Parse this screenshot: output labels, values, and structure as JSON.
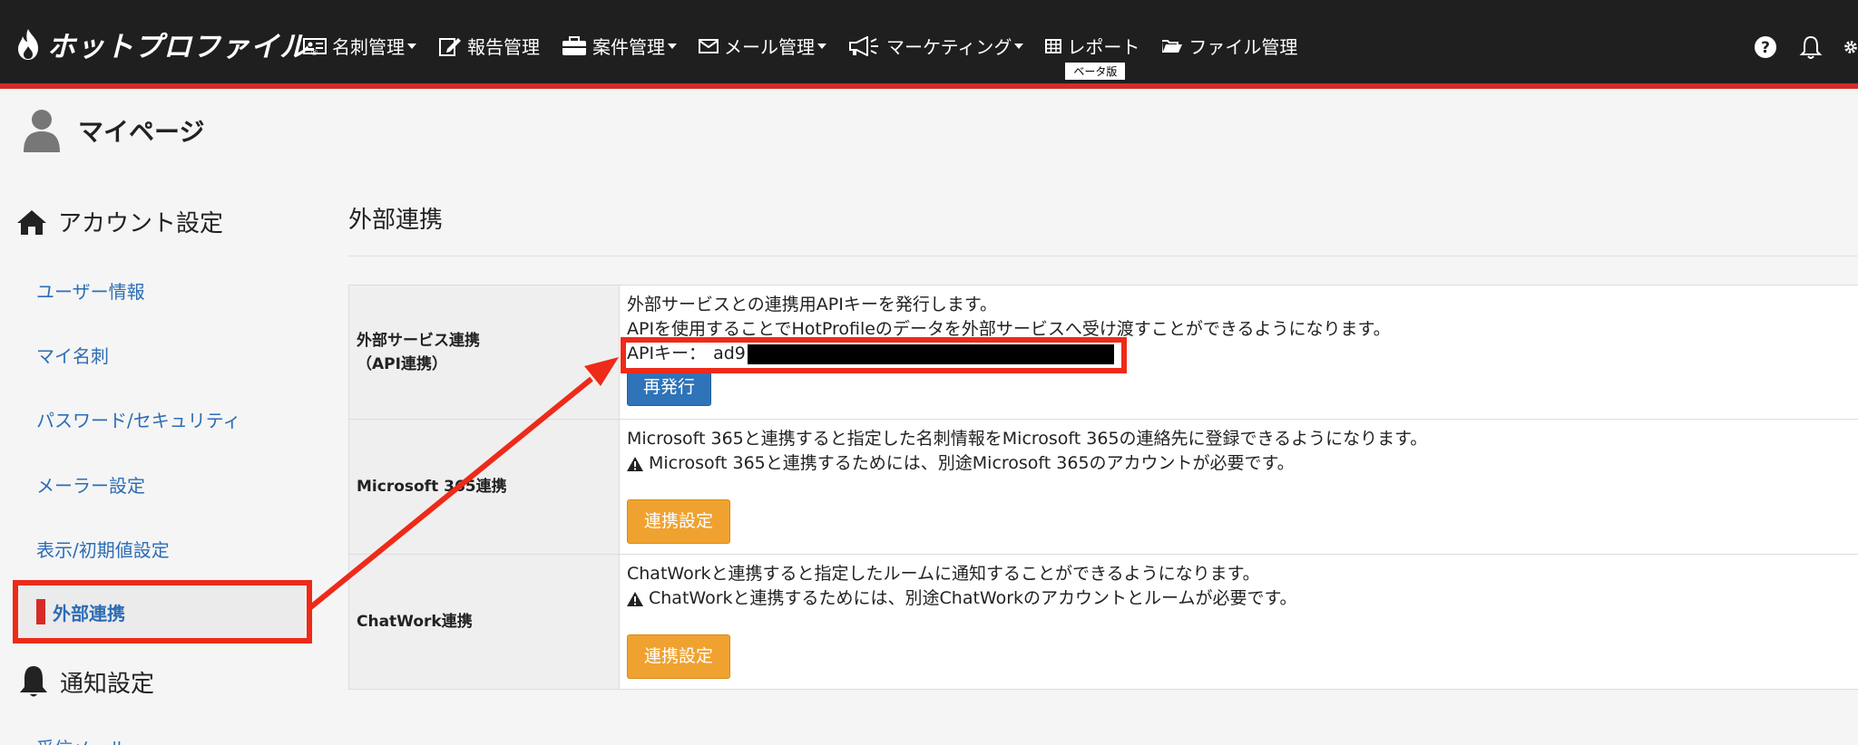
{
  "header": {
    "logo": "ホットプロファイル",
    "logo_mark": "®",
    "nav": [
      {
        "label": "名刺管理",
        "icon": "card-icon",
        "caret": true
      },
      {
        "label": "報告管理",
        "icon": "edit-icon",
        "caret": false
      },
      {
        "label": "案件管理",
        "icon": "briefcase-icon",
        "caret": true
      },
      {
        "label": "メール管理",
        "icon": "mail-icon",
        "caret": true
      },
      {
        "label": "マーケティング",
        "icon": "megaphone-icon",
        "caret": true
      },
      {
        "label": "レポート",
        "icon": "table-icon",
        "caret": false,
        "badge": "ベータ版"
      },
      {
        "label": "ファイル管理",
        "icon": "folder-icon",
        "caret": false
      }
    ],
    "icons": [
      "help-icon",
      "bell-icon",
      "gear-icon"
    ]
  },
  "page": {
    "title": "マイページ"
  },
  "sidebar": {
    "account_section": "アカウント設定",
    "items": [
      "ユーザー情報",
      "マイ名刺",
      "パスワード/セキュリティ",
      "メーラー設定",
      "表示/初期値設定"
    ],
    "active_item": "外部連携",
    "notify_section": "通知設定",
    "next_item_partial": "受信メール"
  },
  "main": {
    "title": "外部連携",
    "rows": [
      {
        "label_line1": "外部サービス連携",
        "label_line2": "（API連携）",
        "text1": "外部サービスとの連携用APIキーを発行します。",
        "text2": "APIを使用することでHotProfileのデータを外部サービスへ受け渡すことができるようになります。",
        "api_label": "APIキー：",
        "api_value_visible": "ad9",
        "button": "再発行"
      },
      {
        "label": "Microsoft 365連携",
        "text1": "Microsoft 365と連携すると指定した名刺情報をMicrosoft 365の連絡先に登録できるようになります。",
        "warning": "Microsoft 365と連携するためには、別途Microsoft 365のアカウントが必要です。",
        "button": "連携設定"
      },
      {
        "label": "ChatWork連携",
        "text1": "ChatWorkと連携すると指定したルームに通知することができるようになります。",
        "warning": "ChatWorkと連携するためには、別途ChatWorkのアカウントとルームが必要です。",
        "button": "連携設定"
      }
    ]
  },
  "colors": {
    "accent_red": "#d62b27",
    "link_blue": "#2d6db5",
    "button_blue": "#2f73b8",
    "button_orange": "#f0a230",
    "annotation_red": "#ee2a19"
  }
}
